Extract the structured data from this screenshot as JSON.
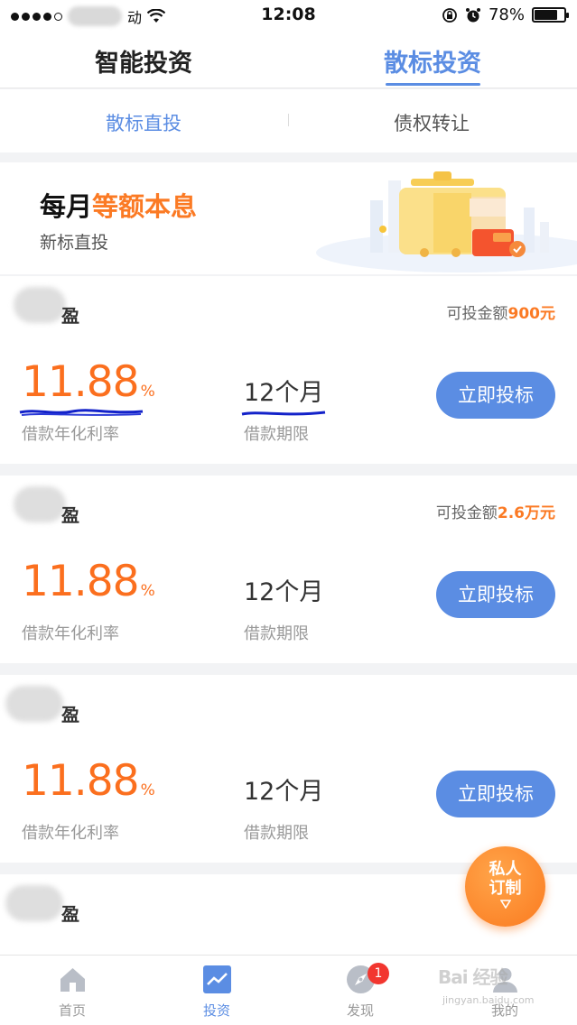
{
  "status_bar": {
    "carrier_tail": "动",
    "time": "12:08",
    "battery": "78%",
    "battery_level": 0.78
  },
  "top_tabs": [
    {
      "label": "智能投资",
      "active": false
    },
    {
      "label": "散标投资",
      "active": true
    }
  ],
  "sub_tabs": [
    {
      "label": "散标直投",
      "active": true
    },
    {
      "label": "债权转让",
      "active": false
    }
  ],
  "banner": {
    "title_plain": "每月",
    "title_accent": "等额本息",
    "subtitle": "新标直投"
  },
  "cards": [
    {
      "name_suffix": "盈",
      "available_label": "可投金额",
      "available_amount": "900元",
      "rate": "11.88",
      "rate_unit": "%",
      "rate_label": "借款年化利率",
      "term": "12个月",
      "term_label": "借款期限",
      "button": "立即投标"
    },
    {
      "name_suffix": "盈",
      "available_label": "可投金额",
      "available_amount": "2.6万元",
      "rate": "11.88",
      "rate_unit": "%",
      "rate_label": "借款年化利率",
      "term": "12个月",
      "term_label": "借款期限",
      "button": "立即投标"
    },
    {
      "name_suffix": "盈",
      "rate": "11.88",
      "rate_unit": "%",
      "rate_label": "借款年化利率",
      "term": "12个月",
      "term_label": "借款期限",
      "button": "立即投标"
    },
    {
      "name_suffix": "盈"
    }
  ],
  "float_button": {
    "line1": "私人",
    "line2": "订制"
  },
  "bottom_nav": [
    {
      "label": "首页",
      "icon": "home-icon",
      "active": false
    },
    {
      "label": "投资",
      "icon": "chart-icon",
      "active": true
    },
    {
      "label": "发现",
      "icon": "compass-icon",
      "active": false,
      "badge": "1"
    },
    {
      "label": "我的",
      "icon": "user-icon",
      "active": false
    }
  ],
  "watermark": {
    "text": "Bai 经验",
    "url": "jingyan.baidu.com"
  },
  "colors": {
    "accent_blue": "#5b8de3",
    "accent_orange": "#fb7a24",
    "badge_red": "#f2362f"
  }
}
